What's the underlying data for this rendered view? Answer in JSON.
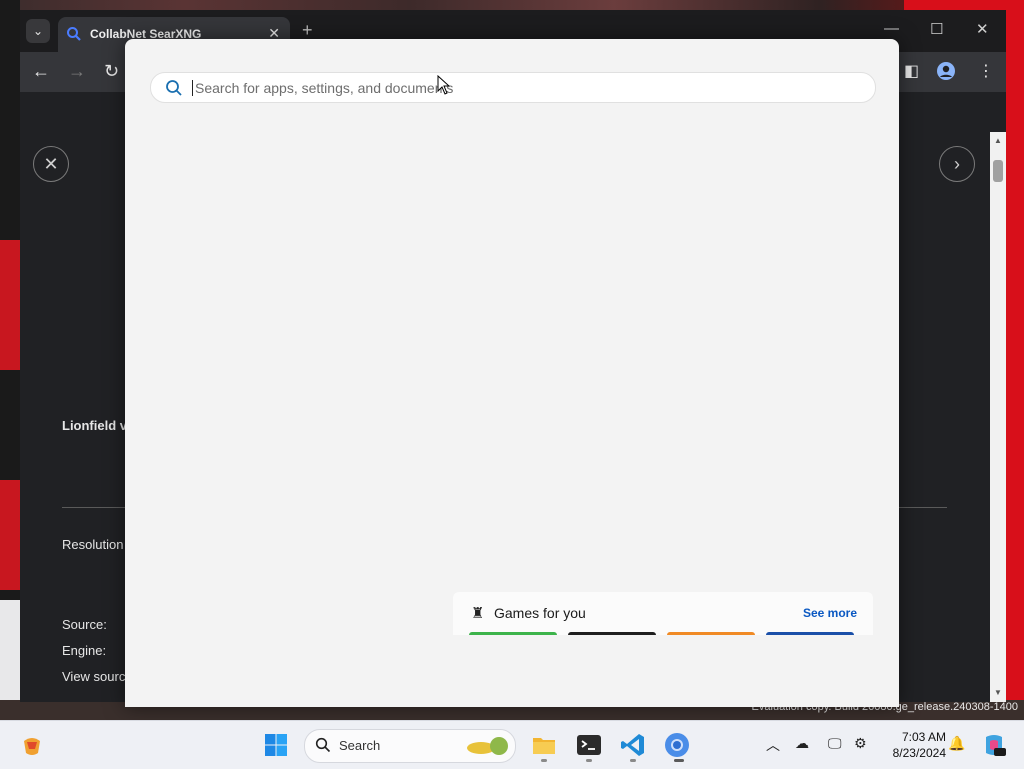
{
  "browser": {
    "tab_title": "CollabNet SearXNG",
    "new_tab": "+",
    "window_controls": {
      "minimize": "—",
      "maximize": "☐",
      "close": "✕"
    }
  },
  "page": {
    "heading_fragment": "Lionfield v",
    "resolution_label": "Resolution",
    "source_label": "Source:",
    "engine_label": "Engine:",
    "view_source_label": "View sourc"
  },
  "start_menu": {
    "search_placeholder": "Search for apps, settings, and documents",
    "search_value": "",
    "games": {
      "title": "Games for you",
      "see_more": "See more",
      "thumb_colors": [
        "#3cb34a",
        "#1e1e1e",
        "#f08a24",
        "#1a4fa8"
      ]
    }
  },
  "desktop": {
    "watermark": "Evaluation copy. Build 26080.ge_release.240308-1400"
  },
  "taskbar": {
    "search_label": "Search",
    "clock_time": "7:03 AM",
    "clock_date": "8/23/2024"
  },
  "colors": {
    "accent": "#0a58c2",
    "browser_bg": "#202124",
    "panel_bg": "#f3f3f3"
  }
}
